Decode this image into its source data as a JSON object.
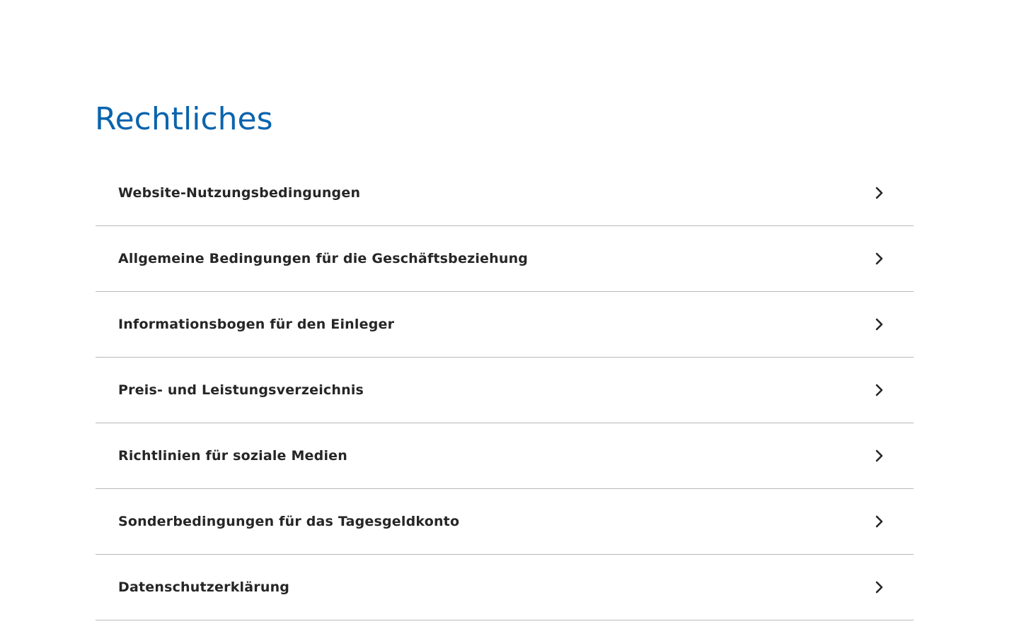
{
  "page": {
    "title": "Rechtliches",
    "accent_color": "#0a64ad",
    "text_color": "#262626",
    "divider_color": "#b9b9b9"
  },
  "items": [
    {
      "label": "Website-Nutzungsbedingungen",
      "icon": "chevron-right-icon"
    },
    {
      "label": "Allgemeine Bedingungen für die Geschäftsbeziehung",
      "icon": "chevron-right-icon"
    },
    {
      "label": "Informationsbogen für den Einleger",
      "icon": "chevron-right-icon"
    },
    {
      "label": "Preis- und Leistungsverzeichnis",
      "icon": "chevron-right-icon"
    },
    {
      "label": "Richtlinien für soziale Medien",
      "icon": "chevron-right-icon"
    },
    {
      "label": "Sonderbedingungen für das Tagesgeldkonto",
      "icon": "chevron-right-icon"
    },
    {
      "label": "Datenschutzerklärung",
      "icon": "chevron-right-icon"
    }
  ]
}
